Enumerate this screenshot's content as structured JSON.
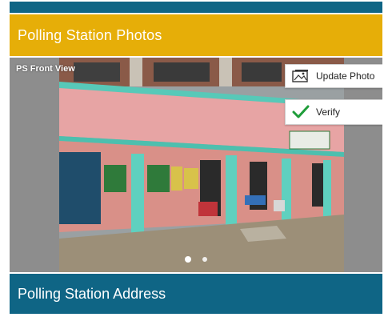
{
  "photos_section": {
    "title": "Polling Station Photos",
    "photo_caption": "PS Front View",
    "update_photo_label": "Update Photo",
    "verify_label": "Verify",
    "carousel": {
      "total": 2,
      "active_index": 0
    }
  },
  "address_section": {
    "title": "Polling Station Address"
  },
  "colors": {
    "primary_blue": "#0f6585",
    "accent_yellow": "#e6ae08",
    "verify_check": "#1f9d3a"
  },
  "icons": {
    "update_photo": "image-icon",
    "verify": "checkmark-icon"
  }
}
